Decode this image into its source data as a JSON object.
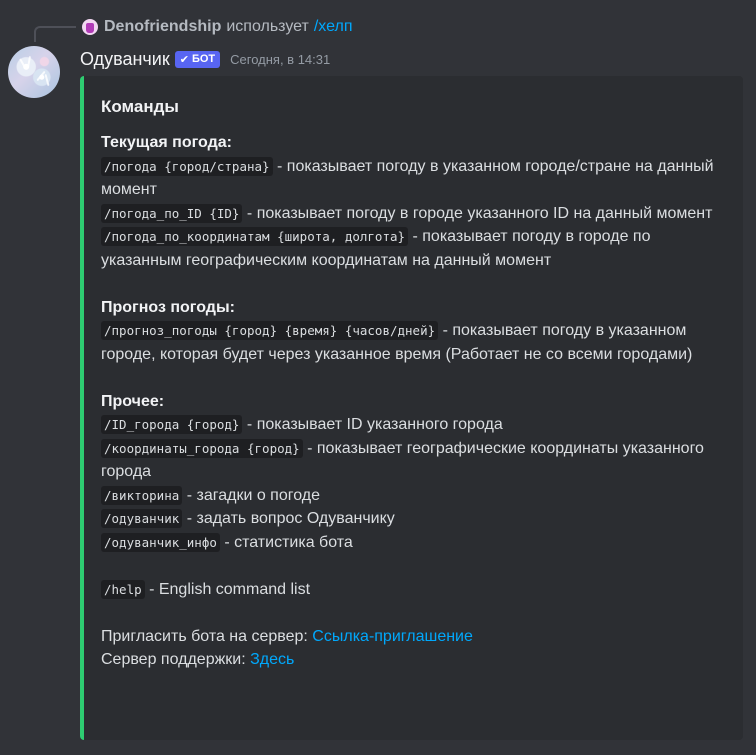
{
  "reply": {
    "username": "Denofriendship",
    "verb": "использует",
    "command": "/хелп"
  },
  "message": {
    "author": "Одуванчик",
    "bot_badge": "БОТ",
    "timestamp": "Сегодня, в 14:31"
  },
  "embed": {
    "accent_color": "#2ecc71",
    "title": "Команды",
    "sections": [
      {
        "title": "Текущая погода:",
        "items": [
          {
            "cmd": "/погода {город/страна}",
            "desc": " - показывает погоду в указанном городе/стране на данный момент"
          },
          {
            "cmd": "/погода_по_ID {ID}",
            "desc": " - показывает погоду в городе указанного ID на данный момент"
          },
          {
            "cmd": "/погода_по_координатам {широта, долгота}",
            "desc": " - показывает погоду в городе по указанным географическим координатам на данный момент"
          }
        ]
      },
      {
        "title": "Прогноз погоды:",
        "items": [
          {
            "cmd": "/прогноз_погоды {город} {время} {часов/дней}",
            "desc": " - показывает погоду в указанном городе, которая будет через указанное время (Работает не со всеми городами)"
          }
        ]
      },
      {
        "title": "Прочее:",
        "items": [
          {
            "cmd": "/ID_города {город}",
            "desc": " - показывает ID указанного города"
          },
          {
            "cmd": "/координаты_города {город}",
            "desc": " - показывает географические координаты указанного города"
          },
          {
            "cmd": "/викторина",
            "desc": " - загадки о погоде"
          },
          {
            "cmd": "/одуванчик",
            "desc": " - задать вопрос Одуванчику"
          },
          {
            "cmd": "/одуванчик_инфо",
            "desc": " - статистика бота"
          }
        ]
      }
    ],
    "help": {
      "cmd": "/help",
      "desc": " - English command list"
    },
    "invite": {
      "label": "Пригласить бота на сервер: ",
      "link": "Ссылка-приглашение"
    },
    "support": {
      "label": "Сервер поддержки: ",
      "link": "Здесь"
    }
  }
}
